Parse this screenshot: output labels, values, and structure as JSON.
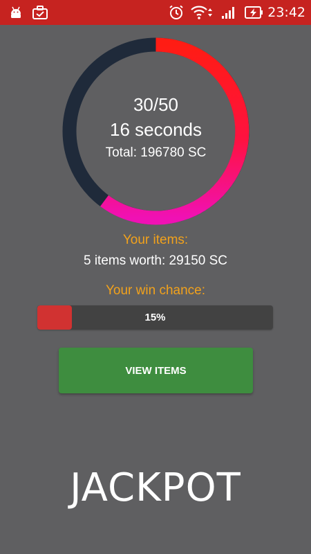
{
  "status_bar": {
    "time": "23:42",
    "left_icons": [
      "android-debug-icon",
      "briefcase-icon"
    ],
    "right_icons": [
      "alarm-icon",
      "wifi-icon",
      "signal-icon",
      "battery-charging-icon"
    ],
    "background": "#c62320"
  },
  "round": {
    "count": "30/50",
    "time_left": "16 seconds",
    "total": "Total: 196780 SC",
    "ring_colors": {
      "dark": "#1f2a3a",
      "red": "#ff1c14",
      "pink": "#f011b4"
    }
  },
  "your_items": {
    "label": "Your items:",
    "summary": "5 items worth: 29150 SC"
  },
  "win_chance": {
    "label": "Your win chance:",
    "percent_text": "15%",
    "fraction": 0.15
  },
  "buttons": {
    "view_items": "VIEW ITEMS"
  },
  "footer": {
    "title": "JACKPOT"
  }
}
